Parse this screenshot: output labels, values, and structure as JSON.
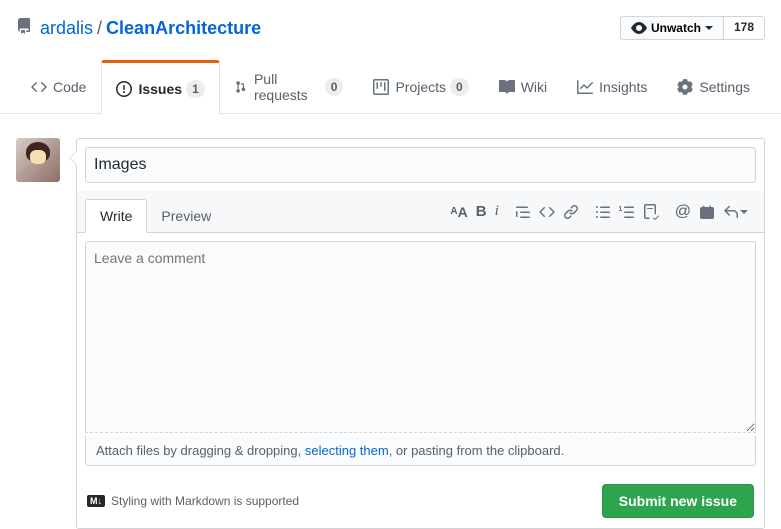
{
  "repo": {
    "owner": "ardalis",
    "name": "CleanArchitecture"
  },
  "watch": {
    "label": "Unwatch",
    "count": "178"
  },
  "tabs": {
    "code": "Code",
    "issues": "Issues",
    "issues_count": "1",
    "pulls": "Pull requests",
    "pulls_count": "0",
    "projects": "Projects",
    "projects_count": "0",
    "wiki": "Wiki",
    "insights": "Insights",
    "settings": "Settings"
  },
  "issue": {
    "title_value": "Images",
    "write_tab": "Write",
    "preview_tab": "Preview",
    "body_placeholder": "Leave a comment",
    "attach_prefix": "Attach files by dragging & dropping, ",
    "attach_link": "selecting them",
    "attach_suffix": ", or pasting from the clipboard.",
    "md_badge": "M↓",
    "md_hint": "Styling with Markdown is supported",
    "submit": "Submit new issue"
  }
}
